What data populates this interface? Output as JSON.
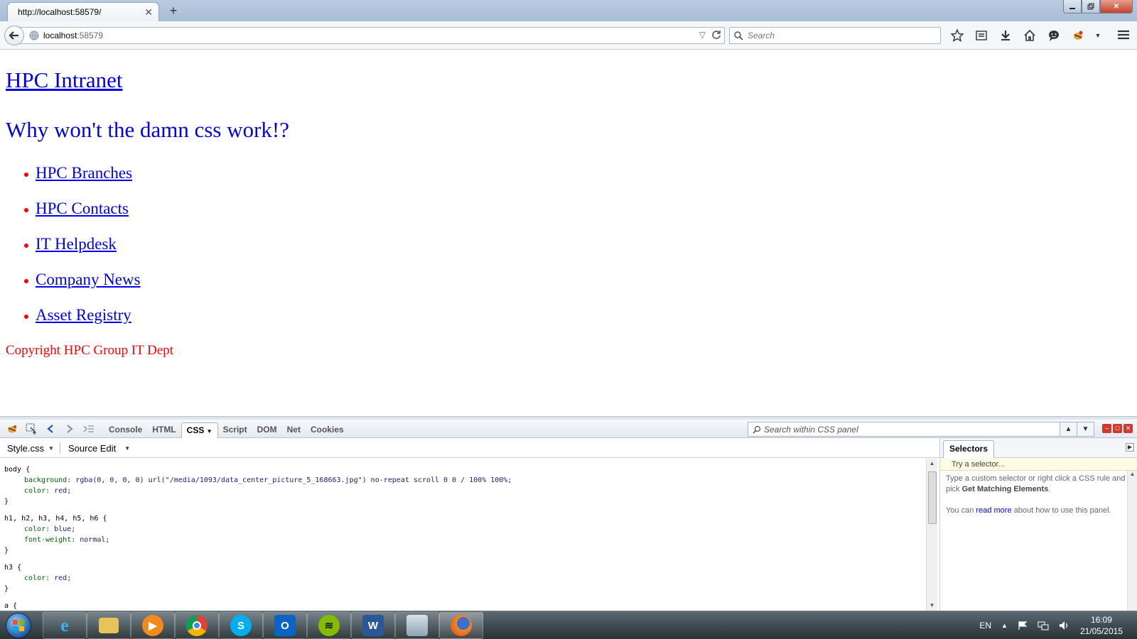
{
  "browser": {
    "tab_title": "http://localhost:58579/",
    "new_tab": "+",
    "url_host": "localhost",
    "url_port": ":58579",
    "search_placeholder": "Search"
  },
  "page": {
    "site_title": "HPC Intranet",
    "heading": "Why won't the damn css work!?",
    "nav_links": [
      "HPC Branches",
      "HPC Contacts",
      "IT Helpdesk",
      "Company News",
      "Asset Registry"
    ],
    "copyright": "Copyright HPC Group IT Dept",
    "colors": {
      "link": "#0000ee",
      "text": "#ff0000"
    }
  },
  "firebug": {
    "tabs": [
      "Console",
      "HTML",
      "CSS",
      "Script",
      "DOM",
      "Net",
      "Cookies"
    ],
    "active_tab": "CSS",
    "search_placeholder": "Search within CSS panel",
    "file_select": "Style.css",
    "mode_select": "Source Edit",
    "css_rules": [
      {
        "selector": "body {",
        "props": [
          {
            "name": "background:",
            "value": " rgba(0, 0, 0, 0) url(\"/media/1093/data_center_picture_5_168663.jpg\") no-repeat scroll 0 0 / 100% 100%;"
          },
          {
            "name": "color:",
            "value": " red;"
          }
        ]
      },
      {
        "selector": "h1, h2, h3, h4, h5, h6 {",
        "props": [
          {
            "name": "color:",
            "value": " blue;"
          },
          {
            "name": "font-weight:",
            "value": " normal;"
          }
        ]
      },
      {
        "selector": "h3 {",
        "props": [
          {
            "name": "color:",
            "value": " red;"
          }
        ]
      },
      {
        "selector": "a {",
        "props": []
      }
    ],
    "side": {
      "tab": "Selectors",
      "try_placeholder": "Try a selector...",
      "help1_a": "Type a custom selector or right click a CSS rule and pick ",
      "help1_b": "Get Matching Elements",
      "help1_c": ".",
      "help2_a": "You can ",
      "help2_link": "read more",
      "help2_b": " about how to use this panel."
    }
  },
  "taskbar": {
    "lang": "EN",
    "time": "16:09",
    "date": "21/05/2015"
  }
}
